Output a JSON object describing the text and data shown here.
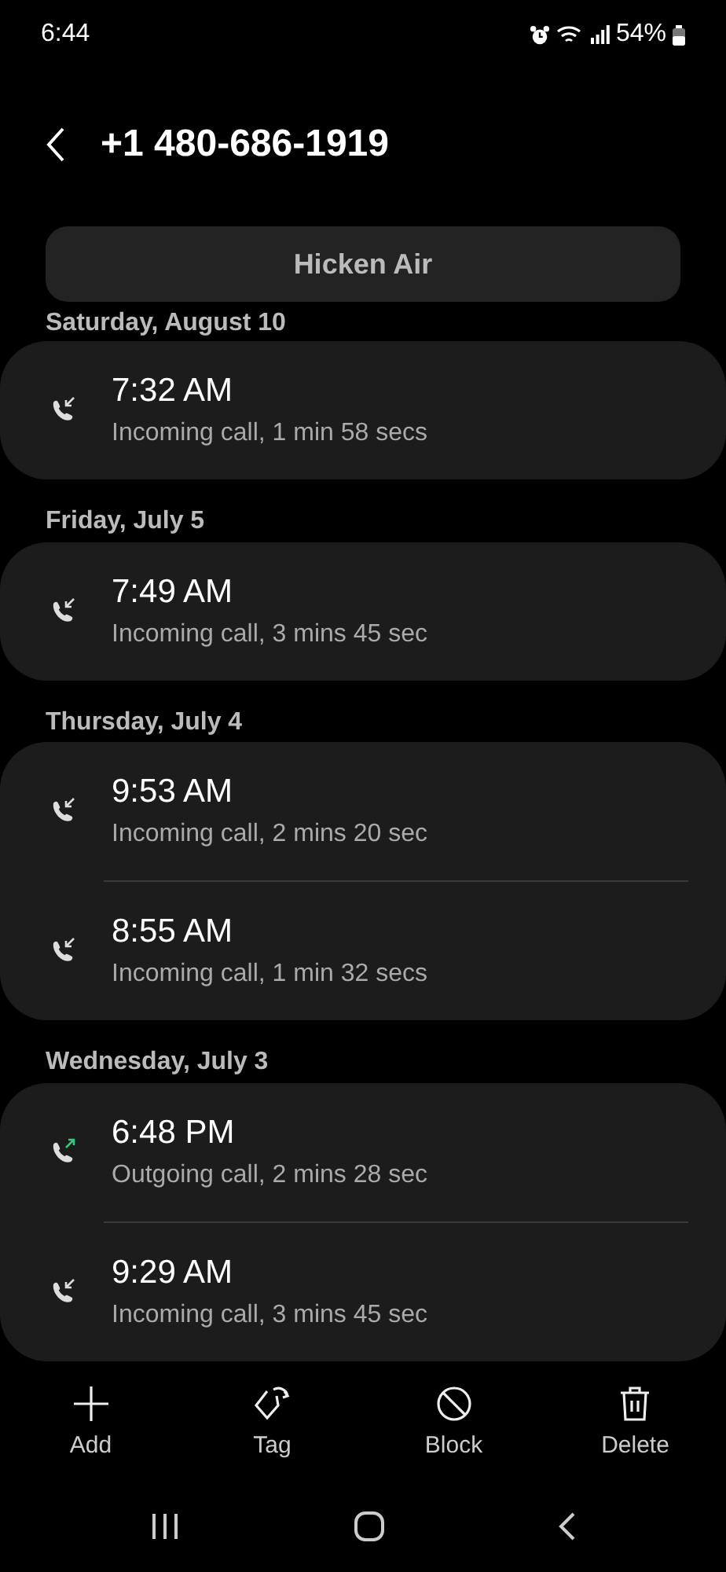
{
  "status_bar": {
    "time": "6:44",
    "battery": "54%"
  },
  "header": {
    "title": "+1 480-686-1919"
  },
  "contact_button": "Hicken Air",
  "groups": [
    {
      "date": "Saturday, August 10",
      "calls": [
        {
          "kind": "incoming",
          "time": "7:32 AM",
          "detail": "Incoming call, 1 min 58 secs"
        }
      ]
    },
    {
      "date": "Friday, July 5",
      "calls": [
        {
          "kind": "incoming",
          "time": "7:49 AM",
          "detail": "Incoming call, 3 mins 45 sec"
        }
      ]
    },
    {
      "date": "Thursday, July 4",
      "calls": [
        {
          "kind": "incoming",
          "time": "9:53 AM",
          "detail": "Incoming call, 2 mins 20 sec"
        },
        {
          "kind": "incoming",
          "time": "8:55 AM",
          "detail": "Incoming call, 1 min 32 secs"
        }
      ]
    },
    {
      "date": "Wednesday, July 3",
      "calls": [
        {
          "kind": "outgoing",
          "time": "6:48 PM",
          "detail": "Outgoing call, 2 mins 28 sec"
        },
        {
          "kind": "incoming",
          "time": "9:29 AM",
          "detail": "Incoming call, 3 mins 45 sec"
        }
      ]
    }
  ],
  "actions": [
    {
      "kind": "add",
      "label": "Add"
    },
    {
      "kind": "tag",
      "label": "Tag"
    },
    {
      "kind": "block",
      "label": "Block"
    },
    {
      "kind": "delete",
      "label": "Delete"
    }
  ]
}
